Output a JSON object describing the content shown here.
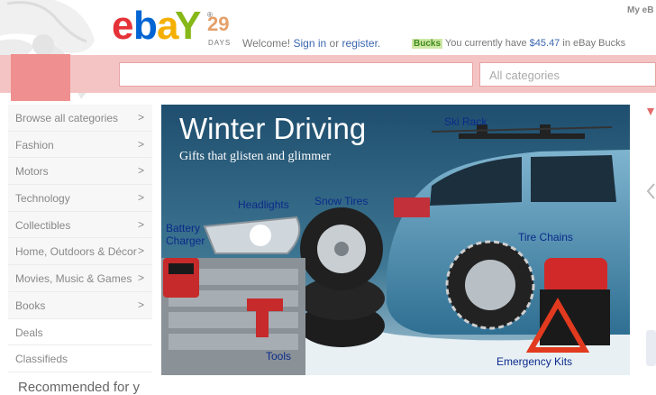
{
  "header": {
    "logo_text": "ebaY",
    "days_number": "29",
    "days_label": "DAYS",
    "welcome_prefix": "Welcome!",
    "sign_in": "Sign in",
    "or": "or",
    "register": "register.",
    "bucks_badge": "Bucks",
    "bucks_text": "You currently have",
    "bucks_amount": "$45.47",
    "bucks_suffix": "in eBay Bucks",
    "my_ebay": "My eB"
  },
  "search": {
    "placeholder": "",
    "category_select": "All categories"
  },
  "menu": {
    "items": [
      {
        "label": "Browse all categories",
        "arrow": ">"
      },
      {
        "label": "Fashion",
        "arrow": ">"
      },
      {
        "label": "Motors",
        "arrow": ">"
      },
      {
        "label": "Technology",
        "arrow": ">"
      },
      {
        "label": "Collectibles",
        "arrow": ">"
      },
      {
        "label": "Home, Outdoors & Décor",
        "arrow": ">"
      },
      {
        "label": "Movies, Music & Games",
        "arrow": ">"
      },
      {
        "label": "Books",
        "arrow": ">"
      },
      {
        "label": "Deals",
        "arrow": ""
      },
      {
        "label": "Classifieds",
        "arrow": ""
      }
    ]
  },
  "hero": {
    "title": "Winter Driving",
    "subtitle": "Gifts that glisten and glimmer",
    "labels": {
      "ski_rack": "Ski Rack",
      "headlights": "Headlights",
      "snow_tires": "Snow Tires",
      "battery_charger_1": "Battery",
      "battery_charger_2": "Charger",
      "tire_chains": "Tire Chains",
      "tools": "Tools",
      "emergency_kits": "Emergency Kits"
    }
  },
  "footer_partial": "Recommended for y",
  "colors": {
    "band": "#f4c4c4",
    "link": "#3a66b0",
    "hero_bg": "#2b5f80",
    "label": "#0b2a8a"
  }
}
